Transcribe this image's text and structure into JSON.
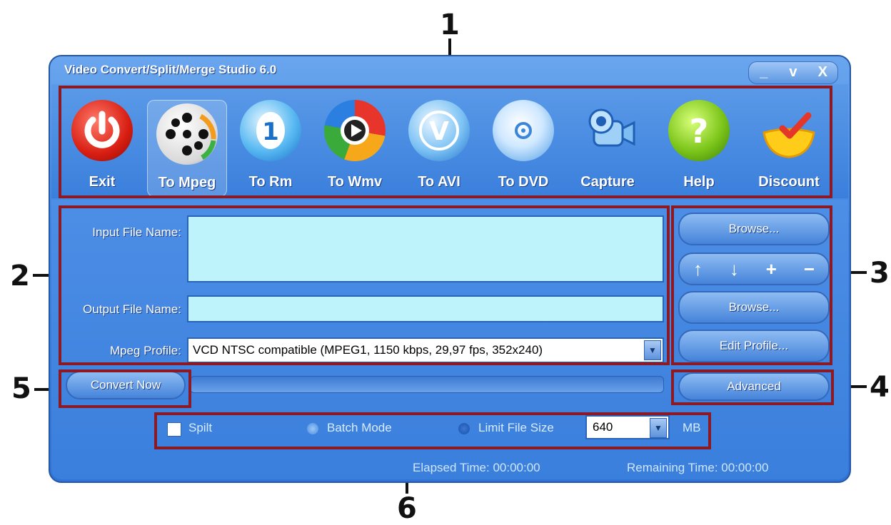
{
  "window": {
    "title": "Video Convert/Split/Merge Studio 6.0",
    "controls": [
      "_",
      "v",
      "X"
    ]
  },
  "toolbar": {
    "items": [
      {
        "label": "Exit",
        "icon": "power-icon"
      },
      {
        "label": "To Mpeg",
        "icon": "film-reel-icon"
      },
      {
        "label": "To Rm",
        "icon": "realmedia-icon"
      },
      {
        "label": "To Wmv",
        "icon": "wmv-play-icon"
      },
      {
        "label": "To AVI",
        "icon": "avi-v-icon"
      },
      {
        "label": "To DVD",
        "icon": "dvd-disc-icon"
      },
      {
        "label": "Capture",
        "icon": "camera-icon"
      },
      {
        "label": "Help",
        "icon": "help-icon"
      },
      {
        "label": "Discount",
        "icon": "discount-bowl-icon"
      }
    ]
  },
  "form": {
    "input_label": "Input File Name:",
    "output_label": "Output File Name:",
    "profile_label": "Mpeg Profile:",
    "profile_value": "VCD NTSC compatible (MPEG1, 1150 kbps, 29,97 fps, 352x240)"
  },
  "side": {
    "browse1": "Browse...",
    "browse2": "Browse...",
    "edit_profile": "Edit Profile...",
    "advanced": "Advanced",
    "arrows": [
      "↑",
      "↓",
      "+",
      "−"
    ]
  },
  "convert": {
    "label": "Convert Now"
  },
  "options": {
    "split": "Spilt",
    "batch": "Batch Mode",
    "limit": "Limit File Size",
    "size_value": "640",
    "size_unit": "MB"
  },
  "status": {
    "elapsed": "Elapsed Time: 00:00:00",
    "remaining": "Remaining Time: 00:00:00"
  },
  "callouts": [
    "1",
    "2",
    "3",
    "4",
    "5",
    "6"
  ]
}
